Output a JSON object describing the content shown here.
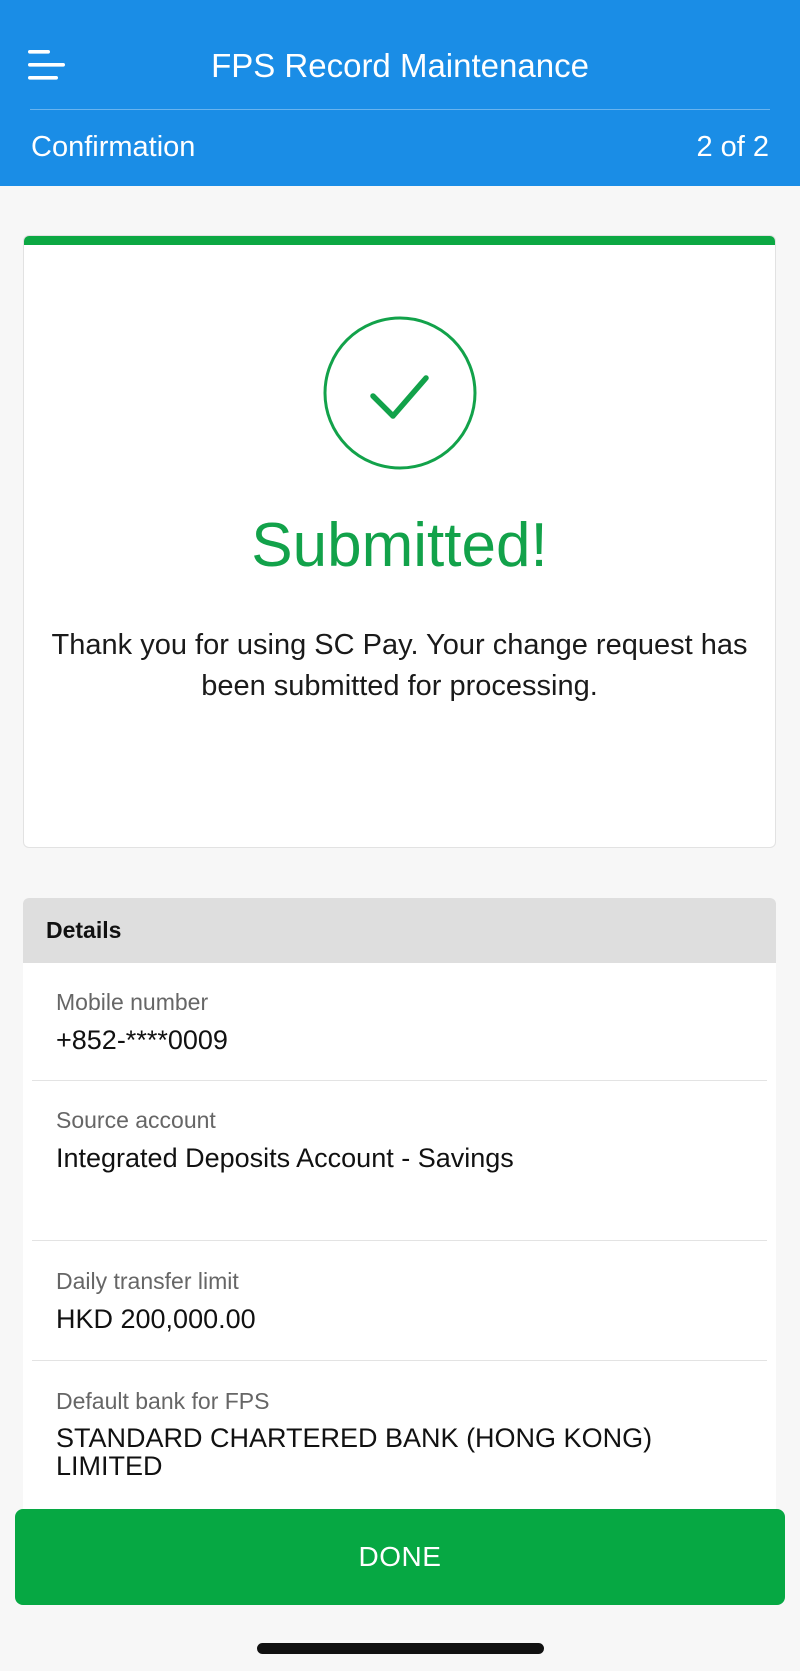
{
  "header": {
    "title": "FPS Record Maintenance",
    "menu_icon": "hamburger-menu-icon",
    "step_label": "Confirmation",
    "step_count": "2 of 2",
    "background_color": "#1a8de6"
  },
  "status": {
    "icon": "check-circle-icon",
    "title": "Submitted!",
    "message": "Thank you for using SC Pay. Your change request has been submitted for processing.",
    "accent_color": "#0ca843"
  },
  "details": {
    "heading": "Details",
    "rows": [
      {
        "label": "Mobile number",
        "value": "+852-****0009"
      },
      {
        "label": "Source account",
        "value": "Integrated Deposits Account - Savings"
      },
      {
        "label": "Daily transfer limit",
        "value": "HKD 200,000.00"
      },
      {
        "label": "Default bank for FPS",
        "value": "STANDARD CHARTERED BANK (HONG KONG) LIMITED"
      }
    ]
  },
  "actions": {
    "done_label": "DONE"
  }
}
